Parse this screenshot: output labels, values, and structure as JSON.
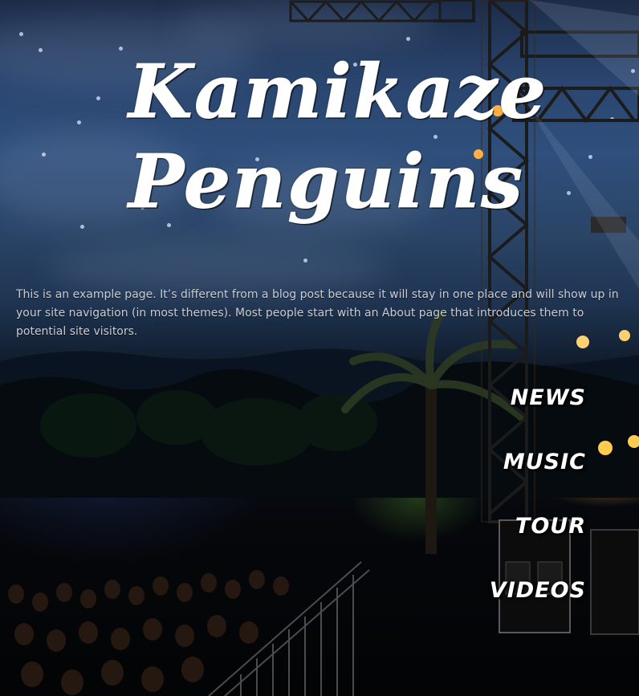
{
  "site": {
    "title_line1": "Kamikaze",
    "title_line2": "Penguins"
  },
  "page": {
    "intro_text": "This is an example page. It’s different from a blog post because it will stay in one place and will show up in your site navigation (in most themes). Most people start with an About page that introduces them to potential site visitors."
  },
  "nav": {
    "items": [
      {
        "label": "NEWS"
      },
      {
        "label": "MUSIC"
      },
      {
        "label": "TOUR"
      },
      {
        "label": "VIDEOS"
      }
    ]
  },
  "colors": {
    "sky": "#2f4f7c",
    "ground": "#05070b",
    "stage_light": "#ffaa3c",
    "text": "#ffffff",
    "intro_text": "#c9ccd2"
  }
}
